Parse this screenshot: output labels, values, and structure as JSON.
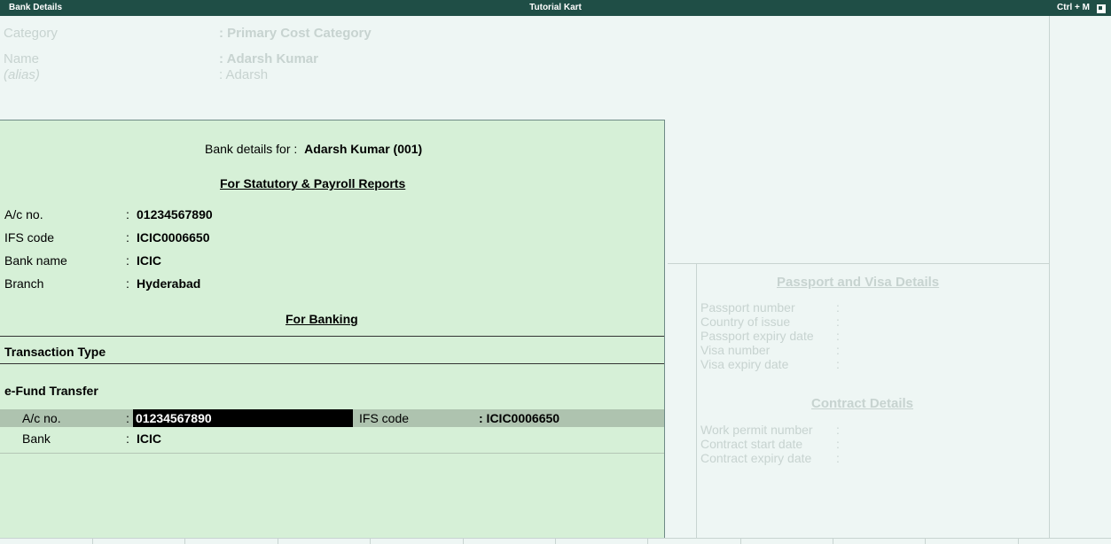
{
  "titlebar": {
    "left_title": "Bank Details",
    "center_title": "Tutorial Kart",
    "shortcut": "Ctrl + M"
  },
  "background_form": {
    "category_label": "Category",
    "category_value": ": Primary Cost Category",
    "name_label": "Name",
    "name_value": ": Adarsh Kumar",
    "alias_label": "(alias)",
    "alias_value": ": Adarsh"
  },
  "bank_details": {
    "header_prefix": "Bank details for :",
    "header_name": "Adarsh Kumar (001)",
    "statutory_heading": "For Statutory & Payroll Reports",
    "fields": [
      {
        "label": "A/c no.",
        "value": "01234567890"
      },
      {
        "label": "IFS code",
        "value": "ICIC0006650"
      },
      {
        "label": "Bank name",
        "value": "ICIC"
      },
      {
        "label": "Branch",
        "value": "Hyderabad"
      }
    ],
    "colon": ":",
    "banking_heading": "For Banking",
    "transaction_type_label": "Transaction Type",
    "transaction_type_value": "e-Fund Transfer",
    "efund": {
      "ac_label": "A/c no.",
      "ac_value": "01234567890",
      "ifs_label": "IFS code",
      "ifs_value": ": ICIC0006650",
      "bank_label": "Bank",
      "bank_value": "ICIC"
    }
  },
  "passport": {
    "heading": "Passport and Visa Details",
    "fields": [
      "Passport number",
      "Country of issue",
      "Passport expiry date",
      "Visa number",
      "Visa expiry date"
    ],
    "contract_heading": "Contract Details",
    "contract_fields": [
      "Work permit number",
      "Contract start date",
      "Contract expiry date"
    ]
  },
  "colors": {
    "titlebar": "#1f4e46",
    "panel": "#d6f0d7",
    "selection": "#aec3af"
  }
}
